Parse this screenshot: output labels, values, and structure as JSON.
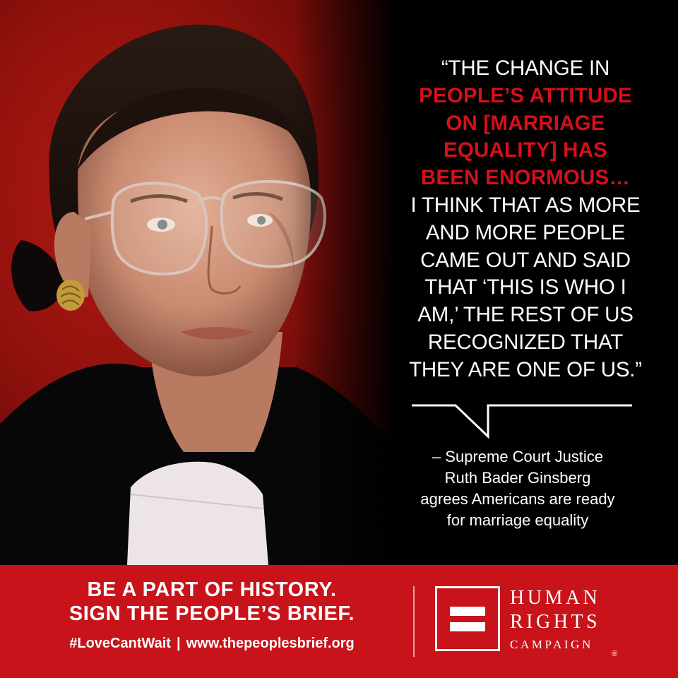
{
  "quote": {
    "lines": [
      {
        "text": "“THE CHANGE IN",
        "accent": false
      },
      {
        "text": "PEOPLE’S ATTITUDE",
        "accent": true
      },
      {
        "text": "ON [MARRIAGE",
        "accent": true
      },
      {
        "text": "EQUALITY] HAS",
        "accent": true
      },
      {
        "text": "BEEN ENORMOUS…",
        "accent": true
      },
      {
        "text": "I THINK THAT AS MORE",
        "accent": false
      },
      {
        "text": "AND MORE PEOPLE",
        "accent": false
      },
      {
        "text": "CAME OUT AND SAID",
        "accent": false
      },
      {
        "text": "THAT ‘THIS IS WHO I",
        "accent": false
      },
      {
        "text": "AM,’ THE REST OF US",
        "accent": false
      },
      {
        "text": "RECOGNIZED THAT",
        "accent": false
      },
      {
        "text": "THEY ARE ONE OF US.”",
        "accent": false
      }
    ]
  },
  "attribution": {
    "lines": [
      "– Supreme Court Justice",
      "Ruth Bader Ginsberg",
      "agrees Americans are ready",
      "for marriage equality"
    ]
  },
  "banner": {
    "headline_1": "BE A PART OF HISTORY.",
    "headline_2": "SIGN THE PEOPLE’S BRIEF.",
    "hashtag": "#LoveCantWait",
    "separator": "|",
    "url": "www.thepeoplesbrief.org"
  },
  "logo": {
    "word_1": "HUMAN",
    "word_2": "RIGHTS",
    "word_3": "CAMPAIGN",
    "registered_mark": "®",
    "icon": "equal-sign-icon"
  },
  "colors": {
    "accent_red": "#d4101a",
    "banner_red": "#c8131b",
    "background": "#000000",
    "text": "#ffffff"
  }
}
